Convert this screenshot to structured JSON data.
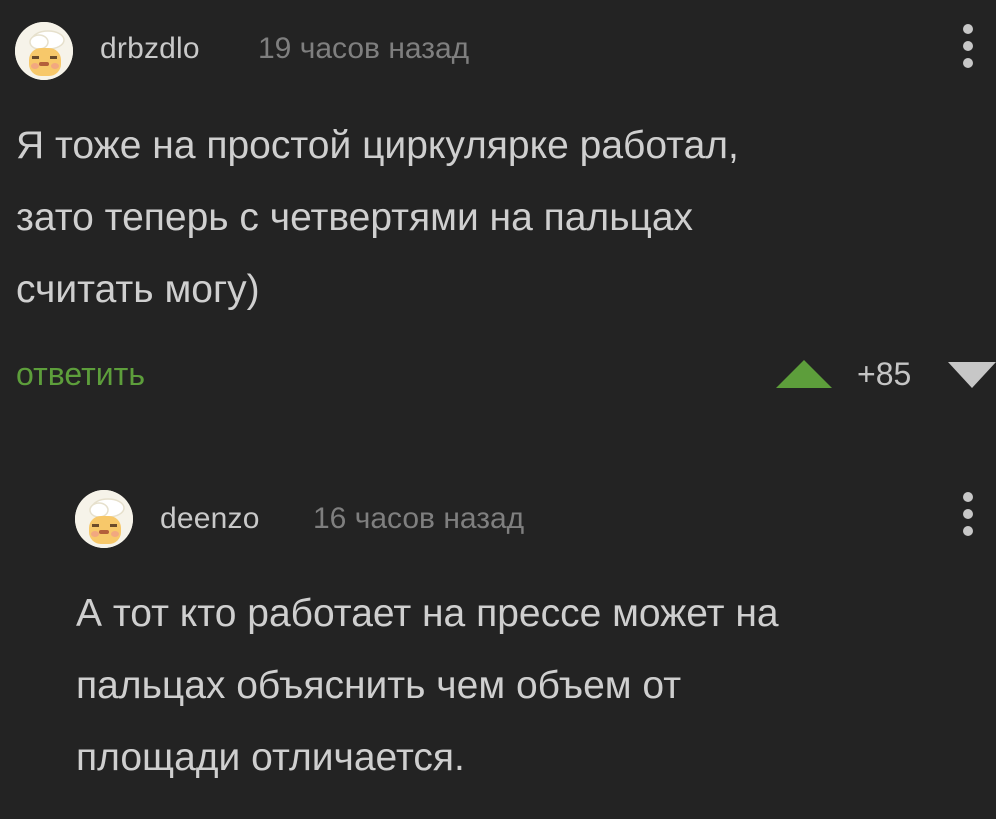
{
  "comments": [
    {
      "username": "drbzdlo",
      "timestamp": "19 часов назад",
      "text_lines": [
        "Я тоже на простой циркулярке работал,",
        "зато теперь с четвертями на пальцах",
        "считать могу)"
      ],
      "reply_label": "ответить",
      "score": "+85",
      "avatar_icon": "chef-cook-avatar-icon",
      "more_icon": "more-vertical-icon",
      "upvote_icon": "upvote-triangle-icon",
      "downvote_icon": "downvote-triangle-icon"
    },
    {
      "username": "deenzo",
      "timestamp": "16 часов назад",
      "text_lines": [
        "А тот кто работает на прессе может на",
        "пальцах объяснить чем объем от",
        "площади отличается."
      ],
      "avatar_icon": "chef-cook-avatar-icon",
      "more_icon": "more-vertical-icon"
    }
  ],
  "colors": {
    "background": "#232323",
    "reply_link": "#5d9e3b",
    "upvote": "#5d9e3b",
    "downvote": "#c7c7c7",
    "text": "#cfcfcf",
    "muted": "#7f7f7f"
  }
}
